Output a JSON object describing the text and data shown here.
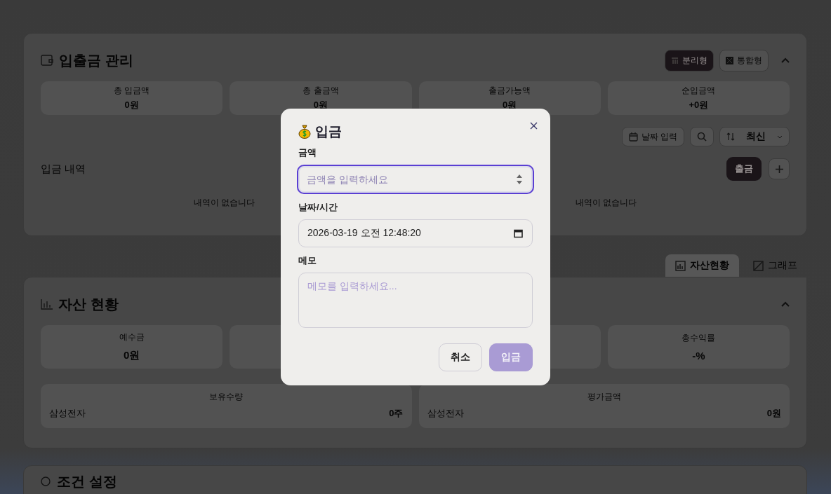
{
  "ledger": {
    "title": "입출금 관리",
    "expanded": true,
    "view_modes": [
      {
        "label": "분리형",
        "selected": true
      },
      {
        "label": "통합형",
        "selected": false
      }
    ],
    "summary": [
      {
        "label": "총 입금액",
        "value": "0원"
      },
      {
        "label": "총 출금액",
        "value": "0원"
      },
      {
        "label": "출금가능액",
        "value": "0원"
      },
      {
        "label": "순입금액",
        "value": "+0원"
      }
    ],
    "toolbar": {
      "date_button": "날짜 입력",
      "sort": "최신"
    },
    "deposit_list": {
      "title": "입금 내역",
      "empty": "내역이 없습니다"
    },
    "withdraw_list": {
      "button": "출금",
      "empty": "내역이 없습니다"
    }
  },
  "asset_tabs": [
    {
      "label": "자산현황",
      "selected": true
    },
    {
      "label": "그래프",
      "selected": false
    }
  ],
  "assets": {
    "title": "자산 현황",
    "expanded": true,
    "summary": [
      {
        "kind": "stat",
        "label": "예수금",
        "value": "0원"
      },
      {
        "kind": "covered"
      },
      {
        "kind": "covered"
      },
      {
        "kind": "stat",
        "label": "총수익률",
        "value": "-%"
      }
    ],
    "holdings": [
      {
        "heading": "보유수량",
        "stock": "삼성전자",
        "value": "0주"
      },
      {
        "heading": "평가금액",
        "stock": "삼성전자",
        "value": "0원"
      }
    ]
  },
  "conditions": {
    "title": "조건 설정"
  },
  "dialog": {
    "title": "입금",
    "fields": [
      {
        "kind": "number",
        "label": "금액",
        "placeholder": "금액을 입력하세요",
        "focused": true
      },
      {
        "kind": "datetime",
        "label": "날짜/시간",
        "value": "2026-03-19 오전 12:48:20",
        "focused": false
      },
      {
        "kind": "textarea",
        "label": "메모",
        "placeholder": "메모를 입력하세요...",
        "focused": false
      }
    ],
    "buttons": [
      {
        "kind": "secondary",
        "label": "취소",
        "disabled": false
      },
      {
        "kind": "primary",
        "label": "입금",
        "disabled": true
      }
    ]
  }
}
